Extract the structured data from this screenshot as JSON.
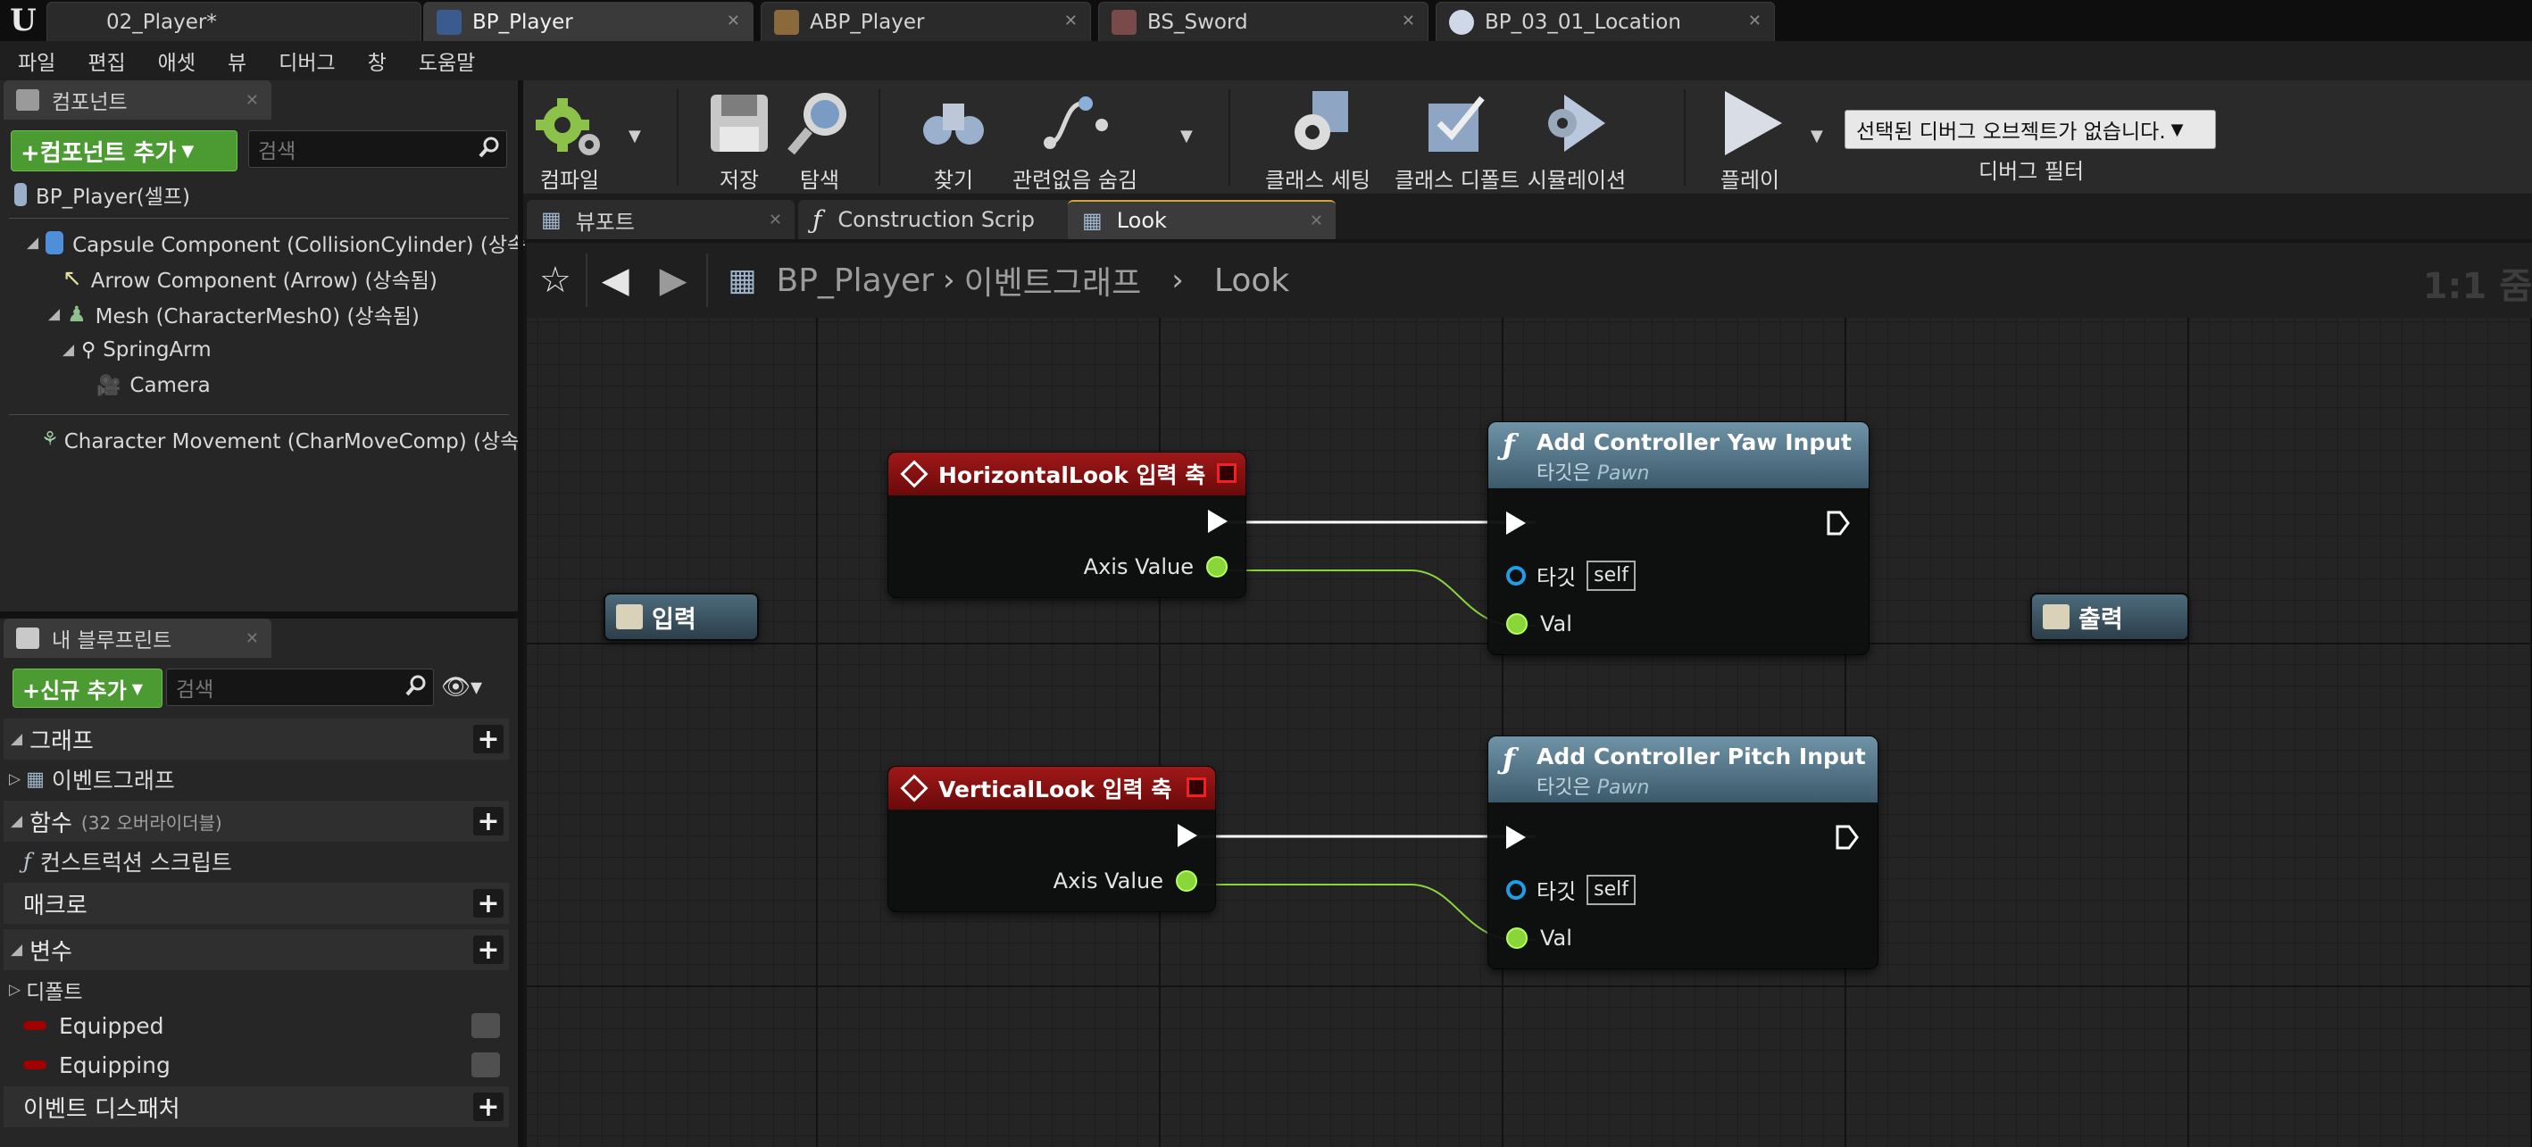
{
  "doc_tabs": [
    {
      "label": "02_Player*"
    },
    {
      "label": "BP_Player"
    },
    {
      "label": "ABP_Player"
    },
    {
      "label": "BS_Sword"
    },
    {
      "label": "BP_03_01_Location"
    }
  ],
  "menu": [
    "파일",
    "편집",
    "애셋",
    "뷰",
    "디버그",
    "창",
    "도움말"
  ],
  "components_panel": {
    "tab_label": "컴포넌트",
    "add_button": "+컴포넌트 추가",
    "search_placeholder": "검색",
    "root": "BP_Player(셀프)",
    "tree": [
      "Capsule Component (CollisionCylinder) (상속",
      "Arrow Component (Arrow) (상속됨)",
      "Mesh (CharacterMesh0) (상속됨)",
      "SpringArm",
      "Camera",
      "Character Movement (CharMoveComp) (상속"
    ]
  },
  "my_blueprint": {
    "tab_label": "내 블루프린트",
    "add_new_button": "+신규 추가",
    "search_placeholder": "검색",
    "sections": {
      "graphs": "그래프",
      "event_graph": "이벤트그래프",
      "functions": "함수",
      "functions_sub": "(32 오버라이더블)",
      "construction_script": "컨스트럭션 스크립트",
      "macros": "매크로",
      "variables": "변수",
      "default_category": "디폴트",
      "event_dispatchers": "이벤트 디스패처"
    },
    "variables": [
      "Equipped",
      "Equipping"
    ]
  },
  "toolbar": {
    "compile": "컴파일",
    "save": "저장",
    "browse": "탐색",
    "find": "찾기",
    "hide_unrelated": "관련없음 숨김",
    "class_settings": "클래스 세팅",
    "class_defaults": "클래스 디폴트",
    "simulation": "시뮬레이션",
    "play": "플레이",
    "debug_object": "선택된 디버그 오브젝트가 없습니다.",
    "debug_filter": "디버그 필터"
  },
  "graph_tabs": [
    {
      "label": "뷰포트"
    },
    {
      "label": "Construction Scrip"
    },
    {
      "label": "Look"
    }
  ],
  "breadcrumb": {
    "blueprint": "BP_Player",
    "graph": "이벤트그래프",
    "collapsed": "Look",
    "zoom": "1:1 줌"
  },
  "graph": {
    "input_tunnel": "입력",
    "output_tunnel": "출력",
    "horizontal_event": {
      "title": "HorizontalLook 입력 축",
      "axis_pin": "Axis Value"
    },
    "vertical_event": {
      "title": "VerticalLook 입력 축",
      "axis_pin": "Axis Value"
    },
    "yaw_node": {
      "title": "Add Controller Yaw Input",
      "sub_prefix": "타깃은",
      "sub_target": "Pawn",
      "target_pin": "타깃",
      "self": "self",
      "val_pin": "Val"
    },
    "pitch_node": {
      "title": "Add Controller Pitch Input",
      "sub_prefix": "타깃은",
      "sub_target": "Pawn",
      "target_pin": "타깃",
      "self": "self",
      "val_pin": "Val"
    }
  },
  "colors": {
    "event_header": "#a01818",
    "function_header": "#5a7d90",
    "float_pin": "#8ad53a",
    "object_pin": "#1fa0e6",
    "exec_wire": "#ffffff",
    "float_wire": "#8ad53a",
    "add_button": "#4c9a32"
  }
}
